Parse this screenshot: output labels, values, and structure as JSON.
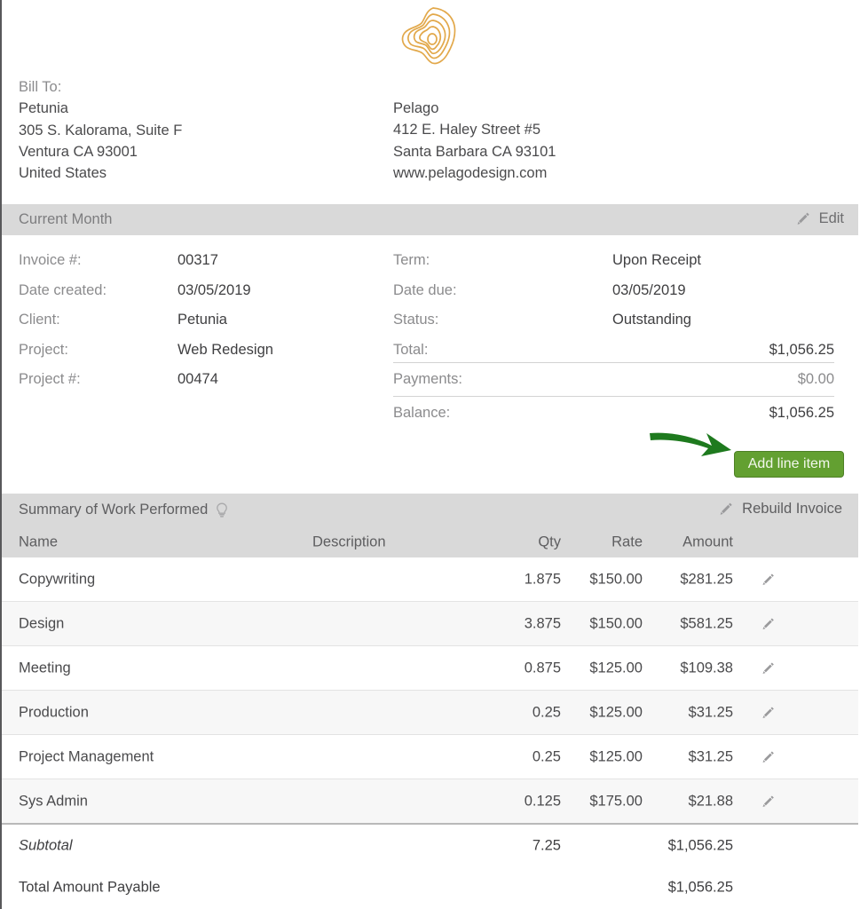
{
  "logo": {
    "name": "pelago-contour-logo",
    "color": "#e2a84a"
  },
  "bill_to": {
    "label": "Bill To:",
    "lines": [
      "Petunia",
      "305 S. Kalorama, Suite F",
      "Ventura CA 93001",
      "United States"
    ]
  },
  "vendor": {
    "lines": [
      "Pelago",
      "412 E. Haley Street #5",
      "Santa Barbara CA 93101",
      "www.pelagodesign.com"
    ]
  },
  "invoice_header": {
    "title": "Current Month",
    "edit_label": "Edit",
    "edit_icon": "pencil-icon"
  },
  "invoice_meta": {
    "left": [
      {
        "label": "Invoice #:",
        "value": "00317"
      },
      {
        "label": "Date created:",
        "value": "03/05/2019"
      },
      {
        "label": "Client:",
        "value": "Petunia"
      },
      {
        "label": "Project:",
        "value": "Web Redesign"
      },
      {
        "label": "Project #:",
        "value": "00474"
      }
    ],
    "right": [
      {
        "label": "Term:",
        "value": "Upon Receipt"
      },
      {
        "label": "Date due:",
        "value": "03/05/2019"
      },
      {
        "label": "Status:",
        "value": "Outstanding"
      },
      {
        "label": "Total:",
        "value": "$1,056.25"
      },
      {
        "label": "Payments:",
        "value": "$0.00"
      },
      {
        "label": "Balance:",
        "value": "$1,056.25"
      }
    ]
  },
  "actions": {
    "add_line_item": "Add line item",
    "add_line_item_color": "#63a031",
    "annotation_arrow_color": "#1e7a1e"
  },
  "summary": {
    "title": "Summary of Work Performed",
    "hint_icon": "lightbulb-icon",
    "rebuild_label": "Rebuild Invoice",
    "rebuild_icon": "pencil-icon",
    "columns": {
      "name": "Name",
      "description": "Description",
      "qty": "Qty",
      "rate": "Rate",
      "amount": "Amount"
    },
    "rows": [
      {
        "name": "Copywriting",
        "description": "",
        "qty": "1.875",
        "rate": "$150.00",
        "amount": "$281.25"
      },
      {
        "name": "Design",
        "description": "",
        "qty": "3.875",
        "rate": "$150.00",
        "amount": "$581.25"
      },
      {
        "name": "Meeting",
        "description": "",
        "qty": "0.875",
        "rate": "$125.00",
        "amount": "$109.38"
      },
      {
        "name": "Production",
        "description": "",
        "qty": "0.25",
        "rate": "$125.00",
        "amount": "$31.25"
      },
      {
        "name": "Project Management",
        "description": "",
        "qty": "0.25",
        "rate": "$125.00",
        "amount": "$31.25"
      },
      {
        "name": "Sys Admin",
        "description": "",
        "qty": "0.125",
        "rate": "$175.00",
        "amount": "$21.88"
      }
    ],
    "subtotal": {
      "name": "Subtotal",
      "qty": "7.25",
      "amount": "$1,056.25"
    },
    "total_payable": {
      "name": "Total Amount Payable",
      "qty": "",
      "amount": "$1,056.25"
    }
  }
}
